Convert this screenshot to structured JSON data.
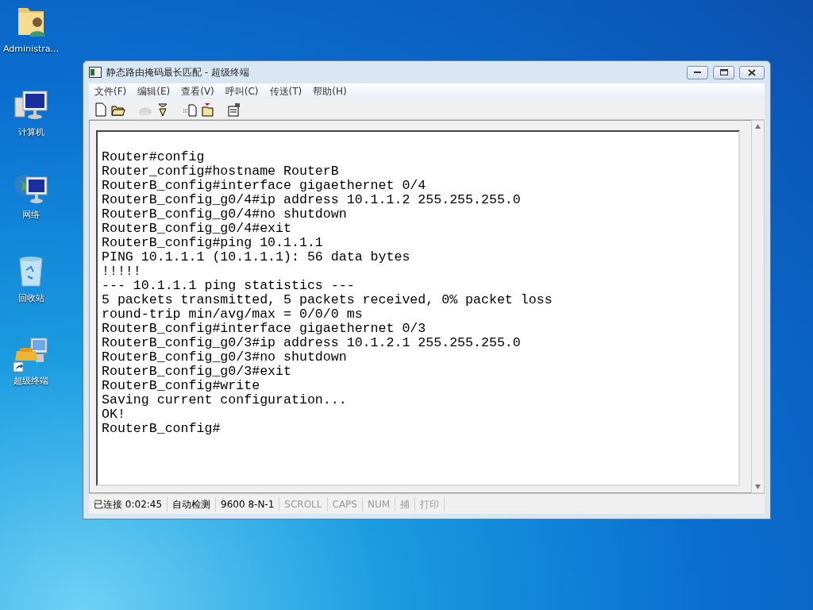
{
  "desktop_icons": [
    {
      "kind": "user-folder",
      "label": "Administra..."
    },
    {
      "kind": "computer",
      "label": "计算机"
    },
    {
      "kind": "network",
      "label": "网络"
    },
    {
      "kind": "recycle-bin",
      "label": "回收站"
    },
    {
      "kind": "terminal-shortcut",
      "label": "超级终端"
    }
  ],
  "window": {
    "title": "静态路由掩码最长匹配 - 超级终端",
    "menu": [
      "文件(F)",
      "编辑(E)",
      "查看(V)",
      "呼叫(C)",
      "传送(T)",
      "帮助(H)"
    ],
    "toolbar": [
      {
        "kind": "new",
        "disabled": false
      },
      {
        "kind": "open",
        "disabled": false
      },
      {
        "kind": "phone",
        "disabled": true
      },
      {
        "kind": "disconnect",
        "disabled": false
      },
      {
        "kind": "send",
        "disabled": false
      },
      {
        "kind": "receive",
        "disabled": false
      },
      {
        "kind": "properties",
        "disabled": false
      }
    ],
    "terminal_lines": [
      "Router#config",
      "Router_config#hostname RouterB",
      "RouterB_config#interface gigaethernet 0/4",
      "RouterB_config_g0/4#ip address 10.1.1.2 255.255.255.0",
      "RouterB_config_g0/4#no shutdown",
      "RouterB_config_g0/4#exit",
      "RouterB_config#ping 10.1.1.1",
      "PING 10.1.1.1 (10.1.1.1): 56 data bytes",
      "!!!!!",
      "--- 10.1.1.1 ping statistics ---",
      "5 packets transmitted, 5 packets received, 0% packet loss",
      "round-trip min/avg/max = 0/0/0 ms",
      "RouterB_config#interface gigaethernet 0/3",
      "RouterB_config_g0/3#ip address 10.1.2.1 255.255.255.0",
      "RouterB_config_g0/3#no shutdown",
      "RouterB_config_g0/3#exit",
      "RouterB_config#write",
      "Saving current configuration...",
      "OK!",
      "RouterB_config#"
    ],
    "status_bar": [
      {
        "text": "已连接 0:02:45",
        "on": true
      },
      {
        "text": "自动检测",
        "on": true
      },
      {
        "text": "9600 8-N-1",
        "on": true
      },
      {
        "text": "SCROLL",
        "on": false
      },
      {
        "text": "CAPS",
        "on": false
      },
      {
        "text": "NUM",
        "on": false
      },
      {
        "text": "捕",
        "on": false
      },
      {
        "text": "打印",
        "on": false
      }
    ]
  }
}
